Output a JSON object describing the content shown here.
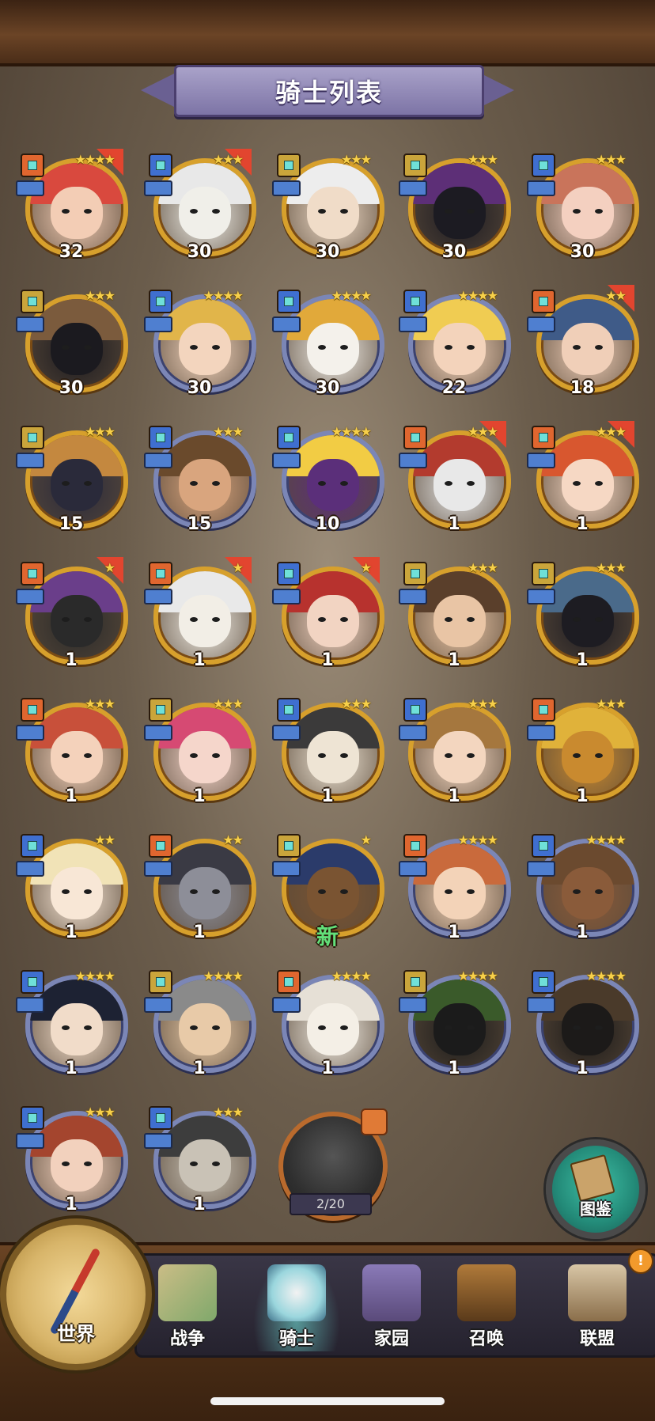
{
  "title": "骑士列表",
  "knights": [
    {
      "count": "32",
      "stars": "★★★★",
      "frame": "red",
      "hair": "#d9493e",
      "skin": "#f3cdb5",
      "role": "#e0662f"
    },
    {
      "count": "30",
      "stars": "★★★",
      "frame": "red",
      "hair": "#e8e8e8",
      "skin": "#f0efe9",
      "role": "#3f6fd0"
    },
    {
      "count": "30",
      "stars": "★★★",
      "frame": "gold",
      "hair": "#ededed",
      "skin": "#f0dcc8",
      "role": "#caa53b"
    },
    {
      "count": "30",
      "stars": "★★★",
      "frame": "gold",
      "hair": "#5d2f77",
      "skin": "#1c1b22",
      "role": "#caa53b"
    },
    {
      "count": "30",
      "stars": "★★★",
      "frame": "gold",
      "hair": "#c9745b",
      "skin": "#f4d0c0",
      "role": "#3f6fd0"
    },
    {
      "count": "30",
      "stars": "★★★",
      "frame": "gold",
      "hair": "#7b5b3d",
      "skin": "#1b1a1f",
      "role": "#caa53b"
    },
    {
      "count": "30",
      "stars": "★★★★",
      "frame": "blue",
      "hair": "#e1b54a",
      "skin": "#f3d5be",
      "role": "#3f6fd0"
    },
    {
      "count": "30",
      "stars": "★★★★",
      "frame": "blue",
      "hair": "#e1a93a",
      "skin": "#f4f1eb",
      "role": "#3f6fd0"
    },
    {
      "count": "22",
      "stars": "★★★★",
      "frame": "blue",
      "hair": "#f0cc52",
      "skin": "#f3d3bb",
      "role": "#3f6fd0"
    },
    {
      "count": "18",
      "stars": "★★",
      "frame": "red",
      "hair": "#3f5b88",
      "skin": "#f0cfb8",
      "role": "#e0662f"
    },
    {
      "count": "15",
      "stars": "★★★",
      "frame": "gold",
      "hair": "#c4883f",
      "skin": "#2a2a3a",
      "role": "#caa53b"
    },
    {
      "count": "15",
      "stars": "★★★",
      "frame": "blue",
      "hair": "#6a4a2c",
      "skin": "#d9a57e",
      "role": "#3f6fd0"
    },
    {
      "count": "10",
      "stars": "★★★★",
      "frame": "blue",
      "hair": "#f2cc44",
      "skin": "#5b2f7a",
      "role": "#3f6fd0"
    },
    {
      "count": "1",
      "stars": "★★★",
      "frame": "red",
      "hair": "#b33b2e",
      "skin": "#e8e8e8",
      "role": "#e0662f"
    },
    {
      "count": "1",
      "stars": "★★★",
      "frame": "red",
      "hair": "#d8572f",
      "skin": "#f6d8c4",
      "role": "#e0662f"
    },
    {
      "count": "1",
      "stars": "★",
      "frame": "red",
      "hair": "#6a3e8a",
      "skin": "#2a2a2a",
      "role": "#e0662f"
    },
    {
      "count": "1",
      "stars": "★",
      "frame": "red",
      "hair": "#e9e9e9",
      "skin": "#f2eee6",
      "role": "#e0662f"
    },
    {
      "count": "1",
      "stars": "★",
      "frame": "red",
      "hair": "#b7322e",
      "skin": "#f2d4c2",
      "role": "#3f6fd0"
    },
    {
      "count": "1",
      "stars": "★★★",
      "frame": "gold",
      "hair": "#5a3f2b",
      "skin": "#e9c5a5",
      "role": "#caa53b"
    },
    {
      "count": "1",
      "stars": "★★★",
      "frame": "gold",
      "hair": "#4a6a8a",
      "skin": "#1d1c22",
      "role": "#caa53b"
    },
    {
      "count": "1",
      "stars": "★★★",
      "frame": "gold",
      "hair": "#c8503a",
      "skin": "#f4d2bb",
      "role": "#e0662f"
    },
    {
      "count": "1",
      "stars": "★★★",
      "frame": "gold",
      "hair": "#d64a73",
      "skin": "#f5d6cb",
      "role": "#caa53b"
    },
    {
      "count": "1",
      "stars": "★★★",
      "frame": "gold",
      "hair": "#3b3a3a",
      "skin": "#eee4d4",
      "role": "#3f6fd0"
    },
    {
      "count": "1",
      "stars": "★★★",
      "frame": "gold",
      "hair": "#a5773e",
      "skin": "#f3d6bf",
      "role": "#3f6fd0"
    },
    {
      "count": "1",
      "stars": "★★★",
      "frame": "gold",
      "hair": "#e0b23a",
      "skin": "#c98a2f",
      "role": "#e0662f"
    },
    {
      "count": "1",
      "stars": "★★",
      "frame": "gold",
      "hair": "#f1e3b7",
      "skin": "#f8e7d6",
      "role": "#3f6fd0"
    },
    {
      "count": "1",
      "stars": "★★",
      "frame": "gold",
      "hair": "#3a3a44",
      "skin": "#8d8e98",
      "role": "#e0662f"
    },
    {
      "count": "新",
      "stars": "★",
      "frame": "gold",
      "hair": "#2b3b6a",
      "skin": "#7a5432",
      "role": "#caa53b",
      "isNew": true
    },
    {
      "count": "1",
      "stars": "★★★★",
      "frame": "blue",
      "hair": "#c96a3c",
      "skin": "#f3d3b8",
      "role": "#e0662f"
    },
    {
      "count": "1",
      "stars": "★★★★",
      "frame": "blue",
      "hair": "#6b4a2f",
      "skin": "#8a5b3a",
      "role": "#3f6fd0"
    },
    {
      "count": "1",
      "stars": "★★★★",
      "frame": "blue",
      "hair": "#1d2233",
      "skin": "#f1dcc9",
      "role": "#3f6fd0"
    },
    {
      "count": "1",
      "stars": "★★★★",
      "frame": "blue",
      "hair": "#8a8a8a",
      "skin": "#e8caa8",
      "role": "#caa53b"
    },
    {
      "count": "1",
      "stars": "★★★★",
      "frame": "blue",
      "hair": "#e6e0d6",
      "skin": "#f4efe6",
      "role": "#e0662f"
    },
    {
      "count": "1",
      "stars": "★★★★",
      "frame": "blue",
      "hair": "#3a5a2a",
      "skin": "#1b1b1b",
      "role": "#caa53b"
    },
    {
      "count": "1",
      "stars": "★★★★",
      "frame": "blue",
      "hair": "#4a3a2a",
      "skin": "#1c1a19",
      "role": "#3f6fd0"
    },
    {
      "count": "1",
      "stars": "★★★",
      "frame": "blue",
      "hair": "#a4452e",
      "skin": "#f2d1bd",
      "role": "#3f6fd0"
    },
    {
      "count": "1",
      "stars": "★★★",
      "frame": "blue",
      "hair": "#3d3d3d",
      "skin": "#c9c2b6",
      "role": "#3f6fd0"
    }
  ],
  "locked_progress": "2/20",
  "codex_label": "图鉴",
  "nav": {
    "world": "世界",
    "war": "战争",
    "knights": "骑士",
    "home": "家园",
    "summon": "召唤",
    "alliance": "联盟"
  },
  "alert_symbol": "!",
  "colors": {
    "gold_frame": "#d7a02c",
    "blue_frame": "#7b86b6",
    "new_text": "#62e07a",
    "title_banner": "#8f87b8"
  }
}
